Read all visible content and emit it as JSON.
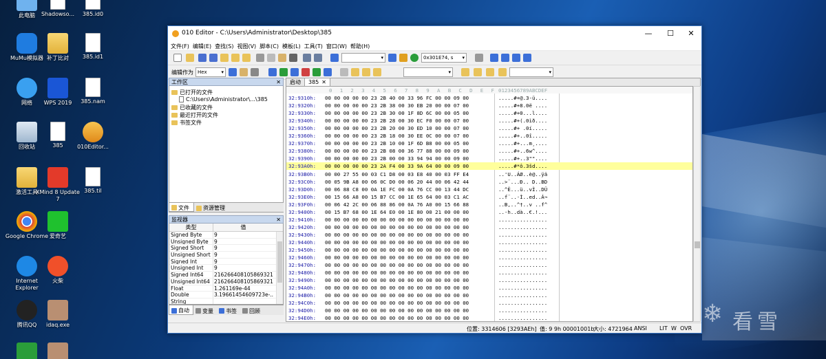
{
  "desktop": {
    "icons": [
      {
        "label": "此电脑"
      },
      {
        "label": "Shadowso..."
      },
      {
        "label": "385.id0"
      },
      {
        "label": "MuMu模拟器"
      },
      {
        "label": "补丁比对"
      },
      {
        "label": "385.id1"
      },
      {
        "label": "网络"
      },
      {
        "label": "WPS 2019"
      },
      {
        "label": "385.nam"
      },
      {
        "label": "回收站"
      },
      {
        "label": "385"
      },
      {
        "label": "010Editor..."
      },
      {
        "label": "激活工具"
      },
      {
        "label": "XMind 8 Update 7"
      },
      {
        "label": "385.til"
      },
      {
        "label": "Google Chrome"
      },
      {
        "label": "爱奇艺"
      },
      {
        "label": "Internet Explorer"
      },
      {
        "label": "火柴"
      },
      {
        "label": "腾讯QQ"
      },
      {
        "label": "idaq.exe"
      }
    ],
    "watermark": "看雪"
  },
  "window": {
    "title": "010 Editor - C:\\Users\\Administrator\\Desktop\\385",
    "controls": {
      "minimize": "—",
      "maximize": "☐",
      "close": "✕"
    },
    "menu": [
      "文件(F)",
      "编辑(E)",
      "查找(S)",
      "视图(V)",
      "脚本(C)",
      "模板(L)",
      "工具(T)",
      "窗口(W)",
      "帮助(H)"
    ],
    "toolbar": {
      "goto_value": "0x301E74, s",
      "edit_as_label": "编辑作为",
      "edit_as_value": "Hex"
    }
  },
  "workspace": {
    "title": "工作区",
    "items": [
      {
        "label": "已打开的文件"
      },
      {
        "label": "C:\\Users\\Administrator\\...\\385"
      },
      {
        "label": "已收藏的文件"
      },
      {
        "label": "最近打开的文件"
      },
      {
        "label": "书签文件"
      }
    ],
    "tabs": [
      "文件",
      "资源管理"
    ]
  },
  "inspector": {
    "title": "监视器",
    "col_type": "类型",
    "col_value": "值",
    "rows": [
      {
        "k": "Signed Byte",
        "v": "9"
      },
      {
        "k": "Unsigned Byte",
        "v": "9"
      },
      {
        "k": "Signed Short",
        "v": "9"
      },
      {
        "k": "Unsigned Short",
        "v": "9"
      },
      {
        "k": "Signed Int",
        "v": "9"
      },
      {
        "k": "Unsigned Int",
        "v": "9"
      },
      {
        "k": "Signed Int64",
        "v": "216266408105869321"
      },
      {
        "k": "Unsigned Int64",
        "v": "216266408105869321"
      },
      {
        "k": "Float",
        "v": "1.261169e-44"
      },
      {
        "k": "Double",
        "v": "3.19661454609723e-..."
      },
      {
        "k": "String",
        "v": ""
      }
    ],
    "tabs": [
      "自动",
      "变量",
      "书签",
      "回顾"
    ]
  },
  "hex": {
    "tabs": [
      "启动",
      "385"
    ],
    "ruler_hex": [
      "0",
      "1",
      "2",
      "3",
      "4",
      "5",
      "6",
      "7",
      "8",
      "9",
      "A",
      "B",
      "C",
      "D",
      "E",
      "F"
    ],
    "ruler_ascii": "0123456789ABCDEF",
    "rows": [
      {
        "addr": "32:9310h:",
        "bytes": "00 00 00 00 00 23 2B 40 00 33 96 FC 00 00 09 00",
        "ascii": ".....#+@.3-ü...."
      },
      {
        "addr": "32:9320h:",
        "bytes": "00 00 00 00 00 23 2B 38 00 30 EB 20 00 00 07 00",
        "ascii": ".....#+8.0ë ...."
      },
      {
        "addr": "32:9330h:",
        "bytes": "00 00 00 00 00 23 2B 30 00 1F 8D 6C 00 00 05 00",
        "ascii": ".....#+0...l...."
      },
      {
        "addr": "32:9340h:",
        "bytes": "00 00 00 00 00 23 2B 28 00 30 EC F0 00 00 07 00",
        "ascii": ".....#+(.0ìð...."
      },
      {
        "addr": "32:9350h:",
        "bytes": "00 00 00 00 00 23 2B 20 00 30 ED 10 00 00 07 00",
        "ascii": ".....#+ .0í....."
      },
      {
        "addr": "32:9360h:",
        "bytes": "00 00 00 00 00 23 2B 18 00 30 EE 0C 00 00 07 00",
        "ascii": ".....#+..0î....."
      },
      {
        "addr": "32:9370h:",
        "bytes": "00 00 00 00 00 23 2B 10 00 1F 6D B8 00 00 05 00",
        "ascii": ".....#+...m¸...."
      },
      {
        "addr": "32:9380h:",
        "bytes": "00 00 00 00 00 23 2B 08 00 36 77 88 00 00 09 00",
        "ascii": ".....#+..6w^...."
      },
      {
        "addr": "32:9390h:",
        "bytes": "00 00 00 00 00 23 2B 00 00 33 94 94 00 00 09 00",
        "ascii": ".....#+..3\"\"...."
      },
      {
        "addr": "32:93A0h:",
        "bytes": "00 00 00 00 00 23 2A F4 00 33 9A 64 00 00 09 00",
        "ascii": ".....#*ô.3šd...."
      },
      {
        "addr": "32:93B0h:",
        "bytes": "00 00 27 55 00 03 C1 D8 00 03 E8 40 00 03 FF E4",
        "ascii": "..'U..ÁØ..è@..ÿä"
      },
      {
        "addr": "32:93C0h:",
        "bytes": "00 05 9B A8 00 06 0C D0 00 06 20 44 00 06 42 44",
        "ascii": "..>¨...Ð.. D..BD"
      },
      {
        "addr": "32:93D0h:",
        "bytes": "00 06 88 C8 00 0A 1E FC 00 0A 76 CC 00 13 44 DC",
        "ascii": "..^È...ü..vÌ..DÜ"
      },
      {
        "addr": "32:93E0h:",
        "bytes": "00 15 66 A8 00 15 B7 CC 00 1E 65 64 00 03 C1 AC",
        "ascii": "..f¨..·Ì..ed..Á¬"
      },
      {
        "addr": "32:93F0h:",
        "bytes": "00 06 42 2C 00 06 88 86 00 0A 76 A0 00 15 66 88",
        "ascii": "..B,..^†..v ..f^"
      },
      {
        "addr": "32:9400h:",
        "bytes": "00 15 B7 68 00 1E 64 E0 00 1E 80 00 21 00 00 00",
        "ascii": "..·h..dà..€.!..."
      },
      {
        "addr": "32:9410h:",
        "bytes": "00 00 00 00 00 00 00 00 00 00 00 00 00 00 00 00",
        "ascii": "................"
      },
      {
        "addr": "32:9420h:",
        "bytes": "00 00 00 00 00 00 00 00 00 00 00 00 00 00 00 00",
        "ascii": "................"
      },
      {
        "addr": "32:9430h:",
        "bytes": "00 00 00 00 00 00 00 00 00 00 00 00 00 00 00 00",
        "ascii": "................"
      },
      {
        "addr": "32:9440h:",
        "bytes": "00 00 00 00 00 00 00 00 00 00 00 00 00 00 00 00",
        "ascii": "................"
      },
      {
        "addr": "32:9450h:",
        "bytes": "00 00 00 00 00 00 00 00 00 00 00 00 00 00 00 00",
        "ascii": "................"
      },
      {
        "addr": "32:9460h:",
        "bytes": "00 00 00 00 00 00 00 00 00 00 00 00 00 00 00 00",
        "ascii": "................"
      },
      {
        "addr": "32:9470h:",
        "bytes": "00 00 00 00 00 00 00 00 00 00 00 00 00 00 00 00",
        "ascii": "................"
      },
      {
        "addr": "32:9480h:",
        "bytes": "00 00 00 00 00 00 00 00 00 00 00 00 00 00 00 00",
        "ascii": "................"
      },
      {
        "addr": "32:9490h:",
        "bytes": "00 00 00 00 00 00 00 00 00 00 00 00 00 00 00 00",
        "ascii": "................"
      },
      {
        "addr": "32:94A0h:",
        "bytes": "00 00 00 00 00 00 00 00 00 00 00 00 00 00 00 00",
        "ascii": "................"
      },
      {
        "addr": "32:94B0h:",
        "bytes": "00 00 00 00 00 00 00 00 00 00 00 00 00 00 00 00",
        "ascii": "................"
      },
      {
        "addr": "32:94C0h:",
        "bytes": "00 00 00 00 00 00 00 00 00 00 00 00 00 00 00 00",
        "ascii": "................"
      },
      {
        "addr": "32:94D0h:",
        "bytes": "00 00 00 00 00 00 00 00 00 00 00 00 00 00 00 00",
        "ascii": "................"
      },
      {
        "addr": "32:94E0h:",
        "bytes": "00 00 00 00 00 00 00 00 00 00 00 00 00 00 00 00",
        "ascii": "................"
      }
    ],
    "highlight_row": 9
  },
  "status": {
    "position": "位置: 3314606 [3293AEh]",
    "value": "值: 9 9h 00001001b",
    "size": "大小: 4721964",
    "encoding": "ANSI",
    "flags": [
      "LIT",
      "W",
      "OVR"
    ]
  },
  "colors": {
    "address": "#1a1aa6",
    "highlight": "#ffff9c",
    "titlebar_border": "#3a76c3",
    "panel_header": "#c8d8ee"
  }
}
